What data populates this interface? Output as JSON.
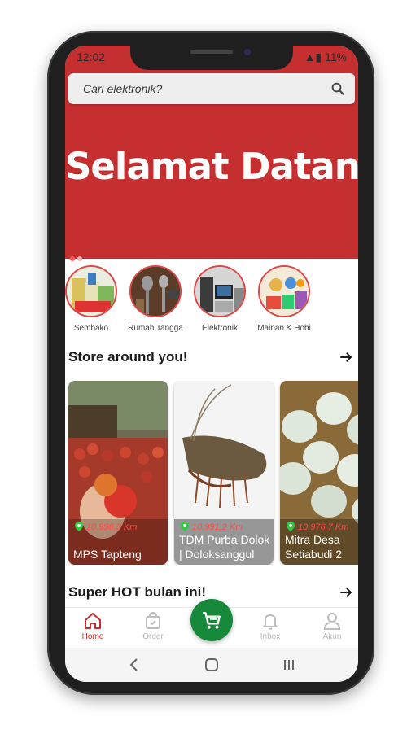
{
  "status": {
    "time": "12:02",
    "battery": "11%"
  },
  "search": {
    "placeholder": "Cari elektronik?"
  },
  "banner": {
    "title": "Selamat Datang"
  },
  "categories": [
    {
      "label": "Sembako"
    },
    {
      "label": "Rumah Tangga"
    },
    {
      "label": "Elektronik"
    },
    {
      "label": "Mainan & Hobi"
    }
  ],
  "stores_section": {
    "title": "Store around you!"
  },
  "stores": [
    {
      "distance": "10.996,3 Km",
      "name": "MPS Tapteng"
    },
    {
      "distance": "10.991,2 Km",
      "name": "TDM Purba Dolok | Doloksanggul"
    },
    {
      "distance": "10.976,7 Km",
      "name": "Mitra Desa Setiabudi 2"
    }
  ],
  "hot_section": {
    "title": "Super HOT bulan ini!"
  },
  "nav": {
    "home": "Home",
    "order": "Order",
    "inbox": "Inbox",
    "akun": "Akun"
  },
  "colors": {
    "brand_red": "#c62f2f",
    "cart_green": "#17893b",
    "distance_red": "#ff4a4a"
  }
}
